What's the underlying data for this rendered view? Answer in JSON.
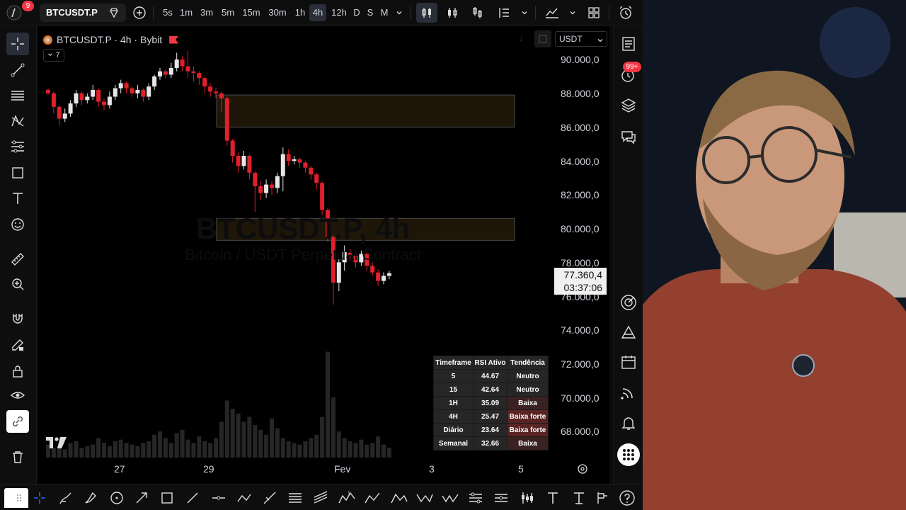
{
  "app": {
    "notification_count": "9",
    "symbol": "BTCUSDT.P"
  },
  "timeframes": [
    "5s",
    "1m",
    "3m",
    "5m",
    "15m",
    "30m",
    "1h",
    "4h",
    "12h",
    "D",
    "S",
    "M"
  ],
  "active_timeframe": "4h",
  "legend": {
    "title": "BTCUSDT.P · 4h · Bybit",
    "indicator_count": "7",
    "watermark_line1": "BTCUSDT.P, 4h",
    "watermark_line2": "Bitcoin / USDT Perpetual Contract"
  },
  "currency_select": "USDT",
  "price_axis": [
    "90.000,0",
    "88.000,0",
    "86.000,0",
    "84.000,0",
    "82.000,0",
    "80.000,0",
    "78.000,0",
    "76.000,0",
    "74.000,0",
    "72.000,0",
    "70.000,0",
    "68.000,0"
  ],
  "last_price": {
    "price": "77.360,4",
    "countdown": "03:37:06"
  },
  "time_axis": [
    "27",
    "29",
    "Fev",
    "3",
    "5"
  ],
  "right_toolbar": {
    "alerts_badge": "99+"
  },
  "rsi_table": {
    "headers": [
      "Timeframe",
      "RSI Ativo",
      "Tendência"
    ],
    "rows": [
      {
        "tf": "5",
        "rsi": "44.67",
        "trend": "Neutro",
        "color": "#262626"
      },
      {
        "tf": "15",
        "rsi": "42.64",
        "trend": "Neutro",
        "color": "#262626"
      },
      {
        "tf": "1H",
        "rsi": "35.09",
        "trend": "Baixa",
        "color": "#3b2222"
      },
      {
        "tf": "4H",
        "rsi": "25.47",
        "trend": "Baixa forte",
        "color": "#5a2424"
      },
      {
        "tf": "Diário",
        "rsi": "23.64",
        "trend": "Baixa forte",
        "color": "#5a2424"
      },
      {
        "tf": "Semanal",
        "rsi": "32.66",
        "trend": "Baixa",
        "color": "#3b2222"
      }
    ]
  },
  "colors": {
    "up": "#e6e6e6",
    "down": "#e0202a",
    "zone_fill": "#1e1608",
    "zone_border": "#4a4a4a",
    "accent": "#2962ff"
  },
  "chart_data": {
    "type": "candlestick",
    "x_labels": [
      "27",
      "29",
      "Fev",
      "3",
      "5"
    ],
    "ylim": [
      66500,
      91200
    ],
    "candles": [
      [
        88200,
        88000,
        88300,
        87900
      ],
      [
        88000,
        87200,
        88100,
        86800
      ],
      [
        87200,
        86500,
        87300,
        86100
      ],
      [
        86500,
        86800,
        87100,
        86300
      ],
      [
        86800,
        87400,
        87600,
        86600
      ],
      [
        87400,
        88000,
        88200,
        87200
      ],
      [
        88000,
        87600,
        88100,
        87300
      ],
      [
        87600,
        87800,
        88000,
        87400
      ],
      [
        87800,
        88200,
        88500,
        87600
      ],
      [
        88200,
        87500,
        88300,
        87200
      ],
      [
        87500,
        87300,
        87700,
        87000
      ],
      [
        87300,
        87800,
        88100,
        87100
      ],
      [
        87800,
        88300,
        88500,
        87600
      ],
      [
        88300,
        88600,
        88800,
        88000
      ],
      [
        88600,
        88300,
        88700,
        88000
      ],
      [
        88300,
        88000,
        88400,
        87800
      ],
      [
        88000,
        88200,
        88500,
        87700
      ],
      [
        88200,
        87800,
        88300,
        87500
      ],
      [
        87800,
        88400,
        88600,
        87600
      ],
      [
        88400,
        89000,
        89100,
        88200
      ],
      [
        89000,
        89300,
        89500,
        88800
      ],
      [
        89300,
        89100,
        89400,
        88900
      ],
      [
        89100,
        89500,
        89800,
        88900
      ],
      [
        89500,
        90000,
        90400,
        89300
      ],
      [
        90000,
        89600,
        90200,
        89300
      ],
      [
        89600,
        89300,
        90500,
        88900
      ],
      [
        89300,
        89200,
        89600,
        88700
      ],
      [
        89200,
        88900,
        89300,
        88500
      ],
      [
        88900,
        88400,
        89000,
        88000
      ],
      [
        88400,
        88100,
        88600,
        87800
      ],
      [
        88100,
        88000,
        88300,
        87700
      ],
      [
        88000,
        87700,
        88100,
        86900
      ],
      [
        87700,
        85200,
        87800,
        84900
      ],
      [
        85200,
        84300,
        85300,
        83900
      ],
      [
        84300,
        83700,
        84500,
        83300
      ],
      [
        83700,
        84300,
        84600,
        83500
      ],
      [
        84300,
        83300,
        84400,
        82900
      ],
      [
        83300,
        82500,
        83400,
        81000
      ],
      [
        82500,
        82100,
        82800,
        81700
      ],
      [
        82100,
        82600,
        82900,
        81800
      ],
      [
        82600,
        82400,
        82800,
        82000
      ],
      [
        82400,
        83100,
        83300,
        82100
      ],
      [
        83100,
        84400,
        84800,
        82200
      ],
      [
        84400,
        84000,
        84700,
        83700
      ],
      [
        84000,
        84100,
        84300,
        83800
      ],
      [
        84100,
        83900,
        84200,
        83600
      ],
      [
        83900,
        83600,
        84000,
        83300
      ],
      [
        83600,
        83200,
        83700,
        82900
      ],
      [
        83200,
        82700,
        83300,
        82300
      ],
      [
        82700,
        81100,
        82800,
        80800
      ],
      [
        81100,
        79500,
        81200,
        79200
      ],
      [
        79500,
        76800,
        79600,
        75500
      ],
      [
        76800,
        78000,
        78200,
        76300
      ],
      [
        78000,
        78600,
        79000,
        77500
      ],
      [
        78600,
        78400,
        78800,
        78100
      ],
      [
        78400,
        78000,
        78600,
        77700
      ],
      [
        78000,
        78500,
        78700,
        77800
      ],
      [
        78500,
        77800,
        78600,
        77500
      ],
      [
        77800,
        77400,
        78000,
        77200
      ],
      [
        77400,
        76900,
        77600,
        76600
      ],
      [
        76900,
        77200,
        77400,
        76700
      ],
      [
        77200,
        77360,
        77500,
        77000
      ]
    ],
    "volumes": [
      8,
      6,
      7,
      5,
      9,
      10,
      6,
      7,
      8,
      12,
      9,
      7,
      10,
      11,
      9,
      8,
      7,
      9,
      10,
      14,
      16,
      12,
      9,
      15,
      17,
      11,
      9,
      13,
      10,
      9,
      12,
      22,
      35,
      30,
      27,
      22,
      25,
      20,
      17,
      14,
      24,
      18,
      12,
      10,
      9,
      8,
      10,
      12,
      14,
      25,
      65,
      37,
      16,
      12,
      10,
      9,
      11,
      8,
      9,
      13,
      8,
      6
    ],
    "zones": [
      {
        "top": 87900,
        "bottom": 86000
      },
      {
        "top": 80600,
        "bottom": 79300
      }
    ]
  }
}
